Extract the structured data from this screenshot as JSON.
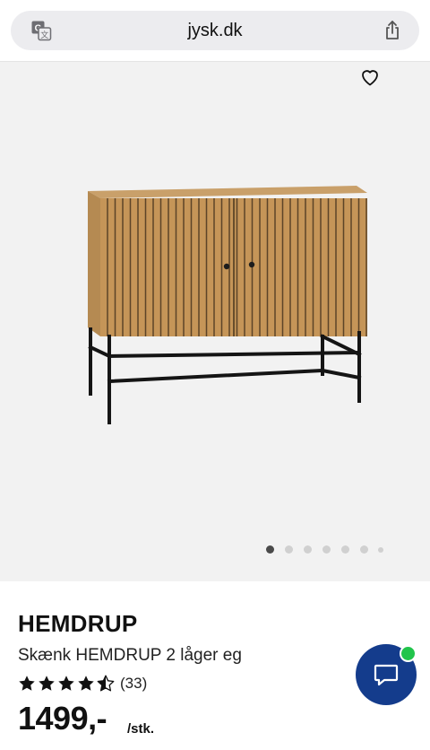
{
  "browser": {
    "url": "jysk.dk",
    "translate_icon": "translate-icon",
    "share_icon": "share-icon"
  },
  "gallery": {
    "favorite_icon": "heart-icon",
    "image_count": 7,
    "active_index": 0
  },
  "product": {
    "name": "HEMDRUP",
    "description": "Skænk HEMDRUP 2 låger eg",
    "rating": 4.5,
    "rating_count": "(33)",
    "price": "1499,-",
    "price_unit": "/stk."
  },
  "chat": {
    "icon": "chat-bubble-icon",
    "status_color": "#21c44b",
    "button_color": "#143c8c"
  }
}
